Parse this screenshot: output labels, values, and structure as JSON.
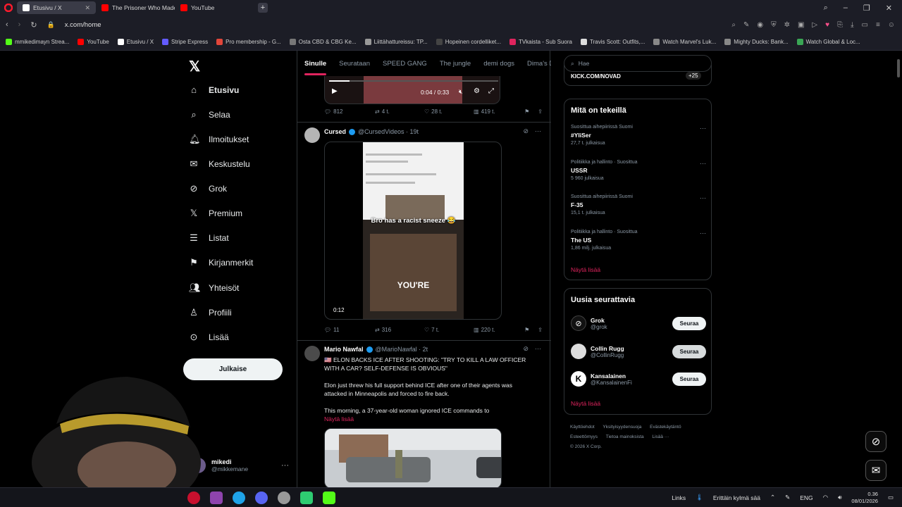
{
  "browser": {
    "tabs": [
      {
        "label": "Etusivu / X",
        "active": true
      },
      {
        "label": "The Prisoner Who Made t",
        "active": false
      },
      {
        "label": "YouTube",
        "active": false
      }
    ],
    "url": "x.com/home",
    "bookmarks": [
      "mmikedimayn Strea...",
      "YouTube",
      "Etusivu / X",
      "Stripe Express",
      "Pro membership - G...",
      "Osta CBD & CBG Ke...",
      "Liittähattureissu: TP...",
      "Hopeinen cordelliket...",
      "TVkaista - Sub Suora",
      "Travis Scott: Outfits,...",
      "Watch Marvel's Luk...",
      "Mighty Ducks: Bank...",
      "Watch Global & Loc..."
    ]
  },
  "nav": {
    "items": [
      {
        "label": "Etusivu",
        "icon": "home-icon"
      },
      {
        "label": "Selaa",
        "icon": "search-icon"
      },
      {
        "label": "Ilmoitukset",
        "icon": "bell-icon"
      },
      {
        "label": "Keskustelu",
        "icon": "mail-icon"
      },
      {
        "label": "Grok",
        "icon": "grok-icon"
      },
      {
        "label": "Premium",
        "icon": "x-logo-icon"
      },
      {
        "label": "Listat",
        "icon": "list-icon"
      },
      {
        "label": "Kirjanmerkit",
        "icon": "bookmark-icon"
      },
      {
        "label": "Yhteisöt",
        "icon": "people-icon"
      },
      {
        "label": "Profiili",
        "icon": "person-icon"
      },
      {
        "label": "Lisää",
        "icon": "more-circle-icon"
      }
    ],
    "post_button": "Julkaise",
    "me": {
      "name": "mikedi",
      "handle": "@mikkemane"
    }
  },
  "feed": {
    "tabs": [
      "Sinulle",
      "Seurataan",
      "SPEED GANG",
      "The jungle",
      "demi dogs",
      "Dima's Di"
    ],
    "video_top": {
      "time": "0:04 / 0:33",
      "stats": [
        "812",
        "4 t.",
        "28 t.",
        "419 t."
      ]
    },
    "post1": {
      "name": "Cursed",
      "handle": "@CursedVideos · 19t",
      "caption": "Bro has a racist sneeze 😂",
      "overlay": "YOU'RE",
      "time": "0:12",
      "stats": [
        "11",
        "316",
        "7 t.",
        "220 t."
      ]
    },
    "post2": {
      "name": "Mario Nawfal",
      "handle": "@MarioNawfal · 2t",
      "headline": "🇺🇸 ELON BACKS ICE AFTER SHOOTING: \"TRY TO KILL A LAW OFFICER WITH A CAR? SELF-DEFENSE IS OBVIOUS\"",
      "para1": "Elon just threw his full support behind ICE after one of their agents was attacked in Minneapolis and forced to fire back.",
      "para2": "This morning, a 37-year-old woman ignored ICE commands to",
      "show_more": "Näytä lisää"
    }
  },
  "right": {
    "search_placeholder": "Hae",
    "promo": {
      "text": "KICK.COM/NOVAD",
      "count": "+25"
    },
    "trends_title": "Mitä on tekeillä",
    "trends": [
      {
        "context": "Suosittua aihepiirissä Suomi",
        "title": "#YliSer",
        "count": "27,7 t. julkaisua"
      },
      {
        "context": "Politiikka ja hallinto · Suosittua",
        "title": "USSR",
        "count": "5 960 julkaisua"
      },
      {
        "context": "Suosittua aihepiirissä Suomi",
        "title": "F-35",
        "count": "15,1 t. julkaisua"
      },
      {
        "context": "Politiikka ja hallinto · Suosittua",
        "title": "The US",
        "count": "1,86 milj. julkaisua"
      }
    ],
    "show_more": "Näytä lisää",
    "who_title": "Uusia seurattavia",
    "who": [
      {
        "name": "Grok",
        "handle": "@grok",
        "button": "Seuraa"
      },
      {
        "name": "Collin Rugg",
        "handle": "@CollinRugg",
        "button": "Seuraa"
      },
      {
        "name": "Kansalainen",
        "handle": "@KansalainenFi",
        "button": "Seuraa"
      }
    ],
    "who_more": "Näytä lisää",
    "footer": [
      "Käyttöehdot",
      "Yksityisyydensuoja",
      "Evästekäytäntö",
      "Esteettömyys",
      "Tietoa mainoksista",
      "Lisää ···",
      "© 2026 X Corp."
    ]
  },
  "taskbar": {
    "links": "Links",
    "weather": "Erittäin kylmä sää",
    "lang": "ENG",
    "time": "0.36",
    "date": "08/01/2026"
  },
  "colors": {
    "accent": "#e0245e",
    "verified": "#1d9bf0",
    "background": "#000000"
  }
}
